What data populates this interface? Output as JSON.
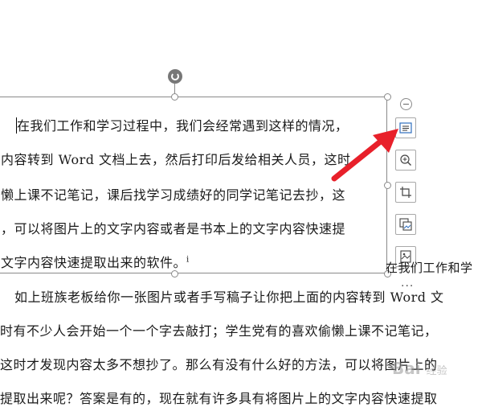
{
  "frame_text": {
    "line1": "在我们工作和学习过程中，我们会经常遇到这样的情况，",
    "line2": "内容转到 Word 文档上去，然后打印后发给相关人员，这时",
    "line3": "懒上课不记笔记，课后找学习成绩好的同学记笔记去抄，这",
    "line4": "，可以将图片上的文字内容或者是书本上的文字内容快速提",
    "line5": "文字内容快速提取出来的软件。",
    "footnote_mark": "i"
  },
  "body_text": {
    "side_fragment": "在我们工作和学",
    "line1": "如上班族老板给你一张图片或者手写稿子让你把上面的内容转到 Word 文",
    "line2": "时有不少人会开始一个一个字去敲打；学生党有的喜欢偷懒上课不记笔记，",
    "line3": "这时才发现内容太多不想抄了。那么有没有什么好的方法，可以将图片上的",
    "line4": "提取出来呢？答案是有的，现在就有许多具有将图片上的文字内容快速提取"
  },
  "toolbar": {
    "more_label": "···"
  },
  "colors": {
    "arrow": "#e8202a",
    "frame": "#8a8a8a"
  },
  "watermark": {
    "brand": "Bai",
    "suffix": "经验"
  }
}
